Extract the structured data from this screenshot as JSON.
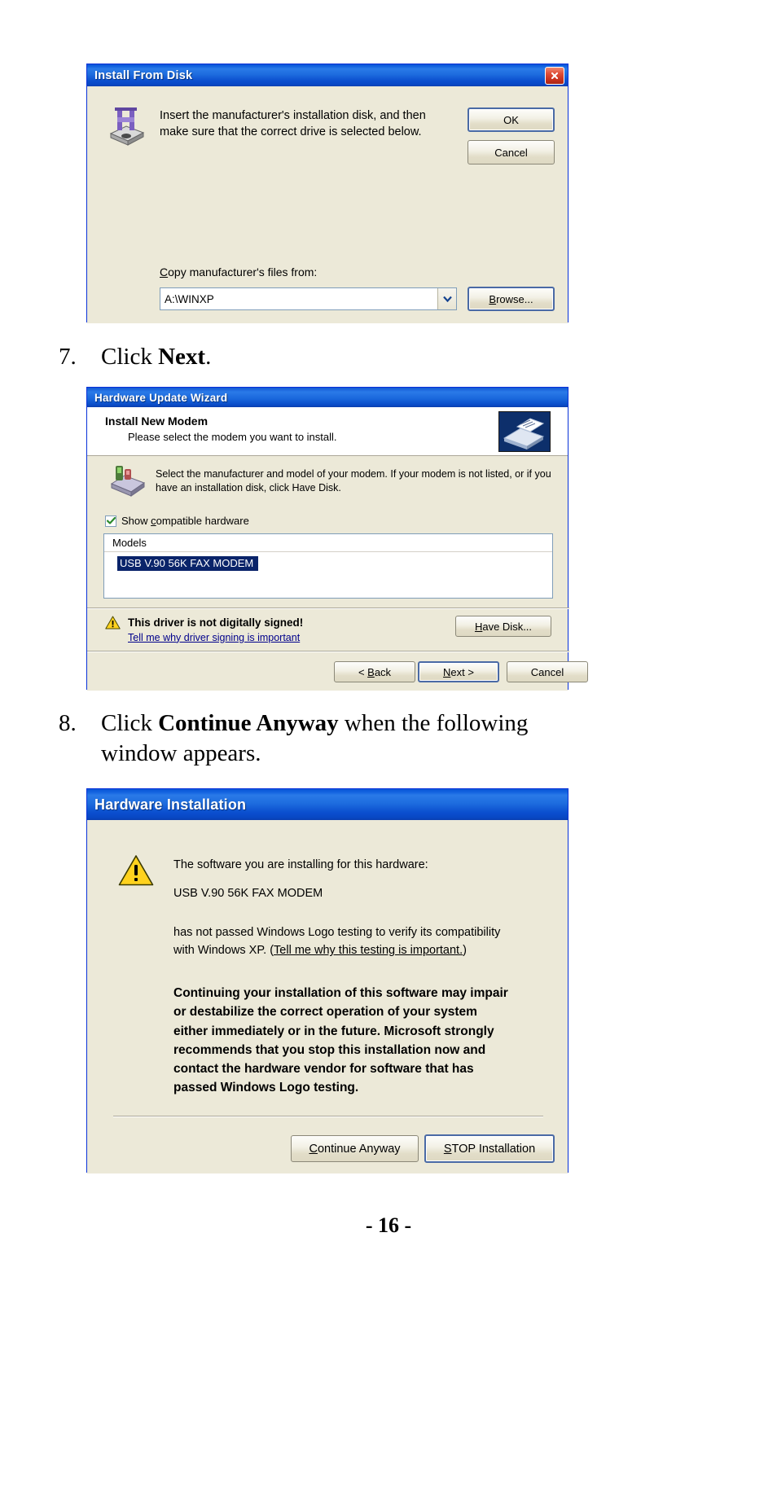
{
  "page": {
    "folio": "- 16 -"
  },
  "dialog1": {
    "title": "Install From Disk",
    "icon": "floppy-disk-icon",
    "close_icon": "close-icon",
    "message_line1": "Insert the manufacturer's installation disk, and then",
    "message_line2": "make sure that the correct drive is selected below.",
    "ok_label": "OK",
    "cancel_label": "Cancel",
    "copy_label_accel": "C",
    "copy_label_rest": "opy manufacturer's files from:",
    "path_value": "A:\\WINXP",
    "browse_accel": "B",
    "browse_prefix": "",
    "browse_label": "Browse...",
    "browse_pre": "",
    "browse_b": "B",
    "browse_post": "rowse..."
  },
  "step7": {
    "number": "7.",
    "text_before": "Click ",
    "bold": "Next",
    "text_after": "."
  },
  "dialog2": {
    "title": "Hardware Update Wizard",
    "header_title": "Install New Modem",
    "header_subtitle": "Please select the modem you want to install.",
    "banner_icon": "modem-banner-icon",
    "body_icon": "modem-icon",
    "body_line1": "Select the manufacturer and model of your modem. If your modem is not listed, or if you",
    "body_line2": "have an installation disk, click Have Disk.",
    "checkbox_checked": true,
    "checkbox_pre": "Show ",
    "checkbox_accel": "c",
    "checkbox_post": "ompatible hardware",
    "list_header": "Models",
    "list_items": [
      "USB V.90 56K FAX MODEM"
    ],
    "selected_index": 0,
    "warning_icon": "warning-triangle-icon",
    "warning_title": "This driver is not digitally signed!",
    "warning_link": "Tell me why driver signing is important",
    "have_disk_accel": "H",
    "have_disk_post": "ave Disk...",
    "back_pre": "< ",
    "back_accel": "B",
    "back_post": "ack",
    "next_accel": "N",
    "next_post": "ext >",
    "cancel_label": "Cancel"
  },
  "step8": {
    "number": "8.",
    "text_before": "Click ",
    "bold": "Continue Anyway",
    "text_after": " when the following",
    "line2": "window appears."
  },
  "dialog3": {
    "title": "Hardware Installation",
    "warning_icon": "warning-triangle-icon",
    "line1": "The software you are installing for this hardware:",
    "line2": "USB V.90 56K FAX MODEM",
    "line3a": "has not passed Windows Logo testing to verify its compatibility",
    "line3b_pre": "with Windows XP. (",
    "line3b_link": "Tell me why this testing is important.",
    "line3b_post": ")",
    "bold_lines": [
      "Continuing your installation of this software may impair",
      "or destabilize the correct operation of your system",
      "either immediately or in the future. Microsoft strongly",
      "recommends that you stop this installation now and",
      "contact the hardware vendor for software that has",
      "passed Windows Logo testing."
    ],
    "continue_accel": "C",
    "continue_post": "ontinue Anyway",
    "stop_accel": "S",
    "stop_post": "TOP Installation"
  },
  "colors": {
    "titlebar_blue": "#0a56d6",
    "dialog_face": "#ece9d8",
    "selection_blue": "#0a246a",
    "link_blue": "#00008b",
    "warning_yellow": "#ffd21e"
  }
}
